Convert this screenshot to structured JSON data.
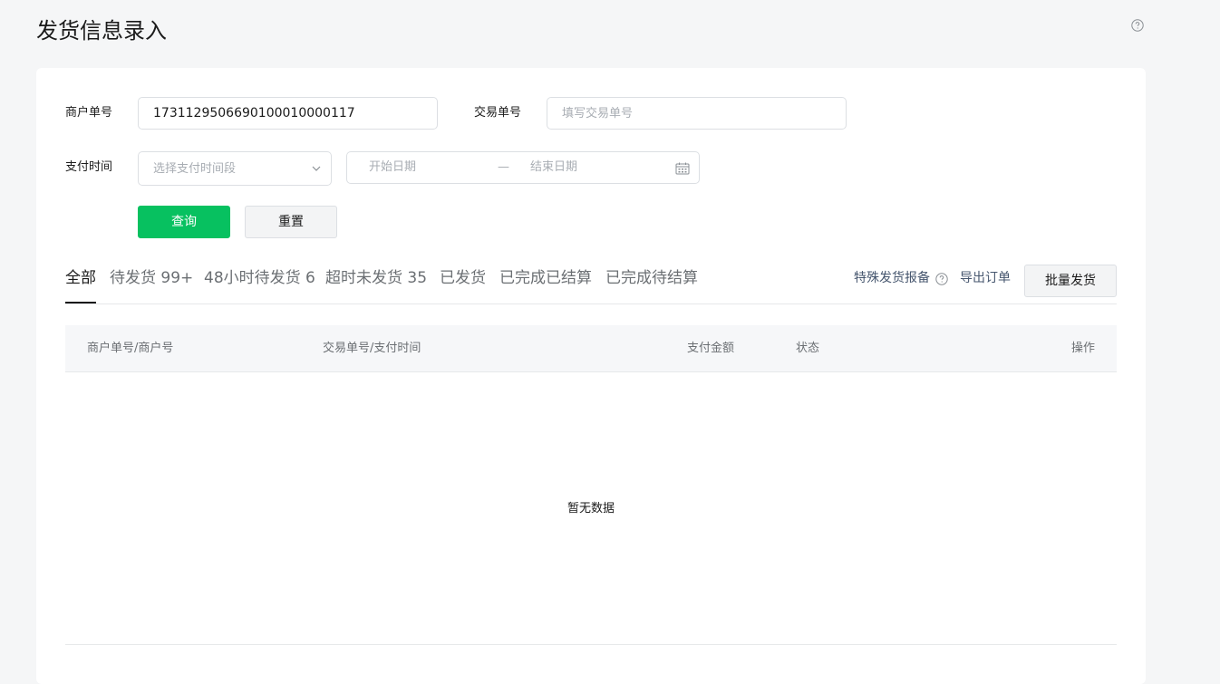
{
  "page": {
    "title": "发货信息录入",
    "help_icon": "question-circle-icon"
  },
  "filters": {
    "merchant_order_label": "商户单号",
    "merchant_order_value": "1731129506690100010000117",
    "transaction_label": "交易单号",
    "transaction_placeholder": "填写交易单号",
    "pay_time_label": "支付时间",
    "pay_time_select_placeholder": "选择支付时间段",
    "start_date_placeholder": "开始日期",
    "date_separator": "—",
    "end_date_placeholder": "结束日期",
    "query_label": "查询",
    "reset_label": "重置"
  },
  "tabs": [
    {
      "label": "全部",
      "active": true
    },
    {
      "label": "待发货 99+",
      "active": false
    },
    {
      "label": "48小时待发货 6",
      "active": false
    },
    {
      "label": "超时未发货 35",
      "active": false
    },
    {
      "label": "已发货",
      "active": false
    },
    {
      "label": "已完成已结算",
      "active": false
    },
    {
      "label": "已完成待结算",
      "active": false
    }
  ],
  "actions": {
    "special_report": "特殊发货报备",
    "export_orders": "导出订单",
    "batch_ship": "批量发货"
  },
  "table": {
    "columns": [
      "商户单号/商户号",
      "交易单号/支付时间",
      "支付金额",
      "状态",
      "操作"
    ],
    "rows": [],
    "empty_text": "暂无数据"
  },
  "colors": {
    "primary": "#07c160",
    "background": "#f5f6f7",
    "card": "#ffffff",
    "link": "#46566e"
  }
}
